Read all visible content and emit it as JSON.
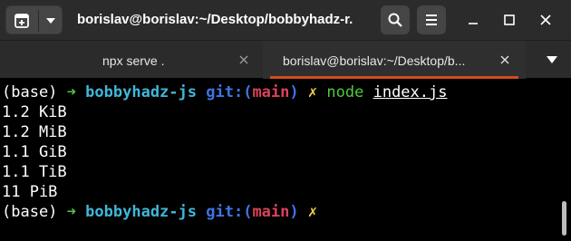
{
  "window": {
    "title": "borislav@borislav:~/Desktop/bobbyhadz-r...",
    "new_tab_icon": "plus-in-window-icon",
    "menu_caret_icon": "chevron-down-icon",
    "search_icon": "search-icon",
    "hamburger_icon": "hamburger-menu-icon",
    "minimize_icon": "minimize-icon",
    "maximize_icon": "maximize-icon",
    "close_icon": "close-icon"
  },
  "tabs": [
    {
      "label": "npx serve .",
      "active": false
    },
    {
      "label": "borislav@borislav:~/Desktop/b...",
      "active": true
    }
  ],
  "terminal": {
    "prompt": {
      "env": "(base)",
      "arrow": "➜",
      "dir": "bobbyhadz-js",
      "git_prefix": "git:(",
      "branch": "main",
      "git_suffix": ")",
      "dirty_mark": "✗"
    },
    "command": "node",
    "command_arg": "index.js",
    "output": [
      "1.2 KiB",
      "1.2 MiB",
      "1.1 GiB",
      "1.1 TiB",
      "11 PiB"
    ]
  },
  "colors": {
    "arrow": "#4ec93d",
    "dir": "#41b6d8",
    "git": "#3f74e6",
    "branch": "#d8435a",
    "dirty_mark": "#f0d24a",
    "active_tab_accent": "#d24c1b"
  }
}
